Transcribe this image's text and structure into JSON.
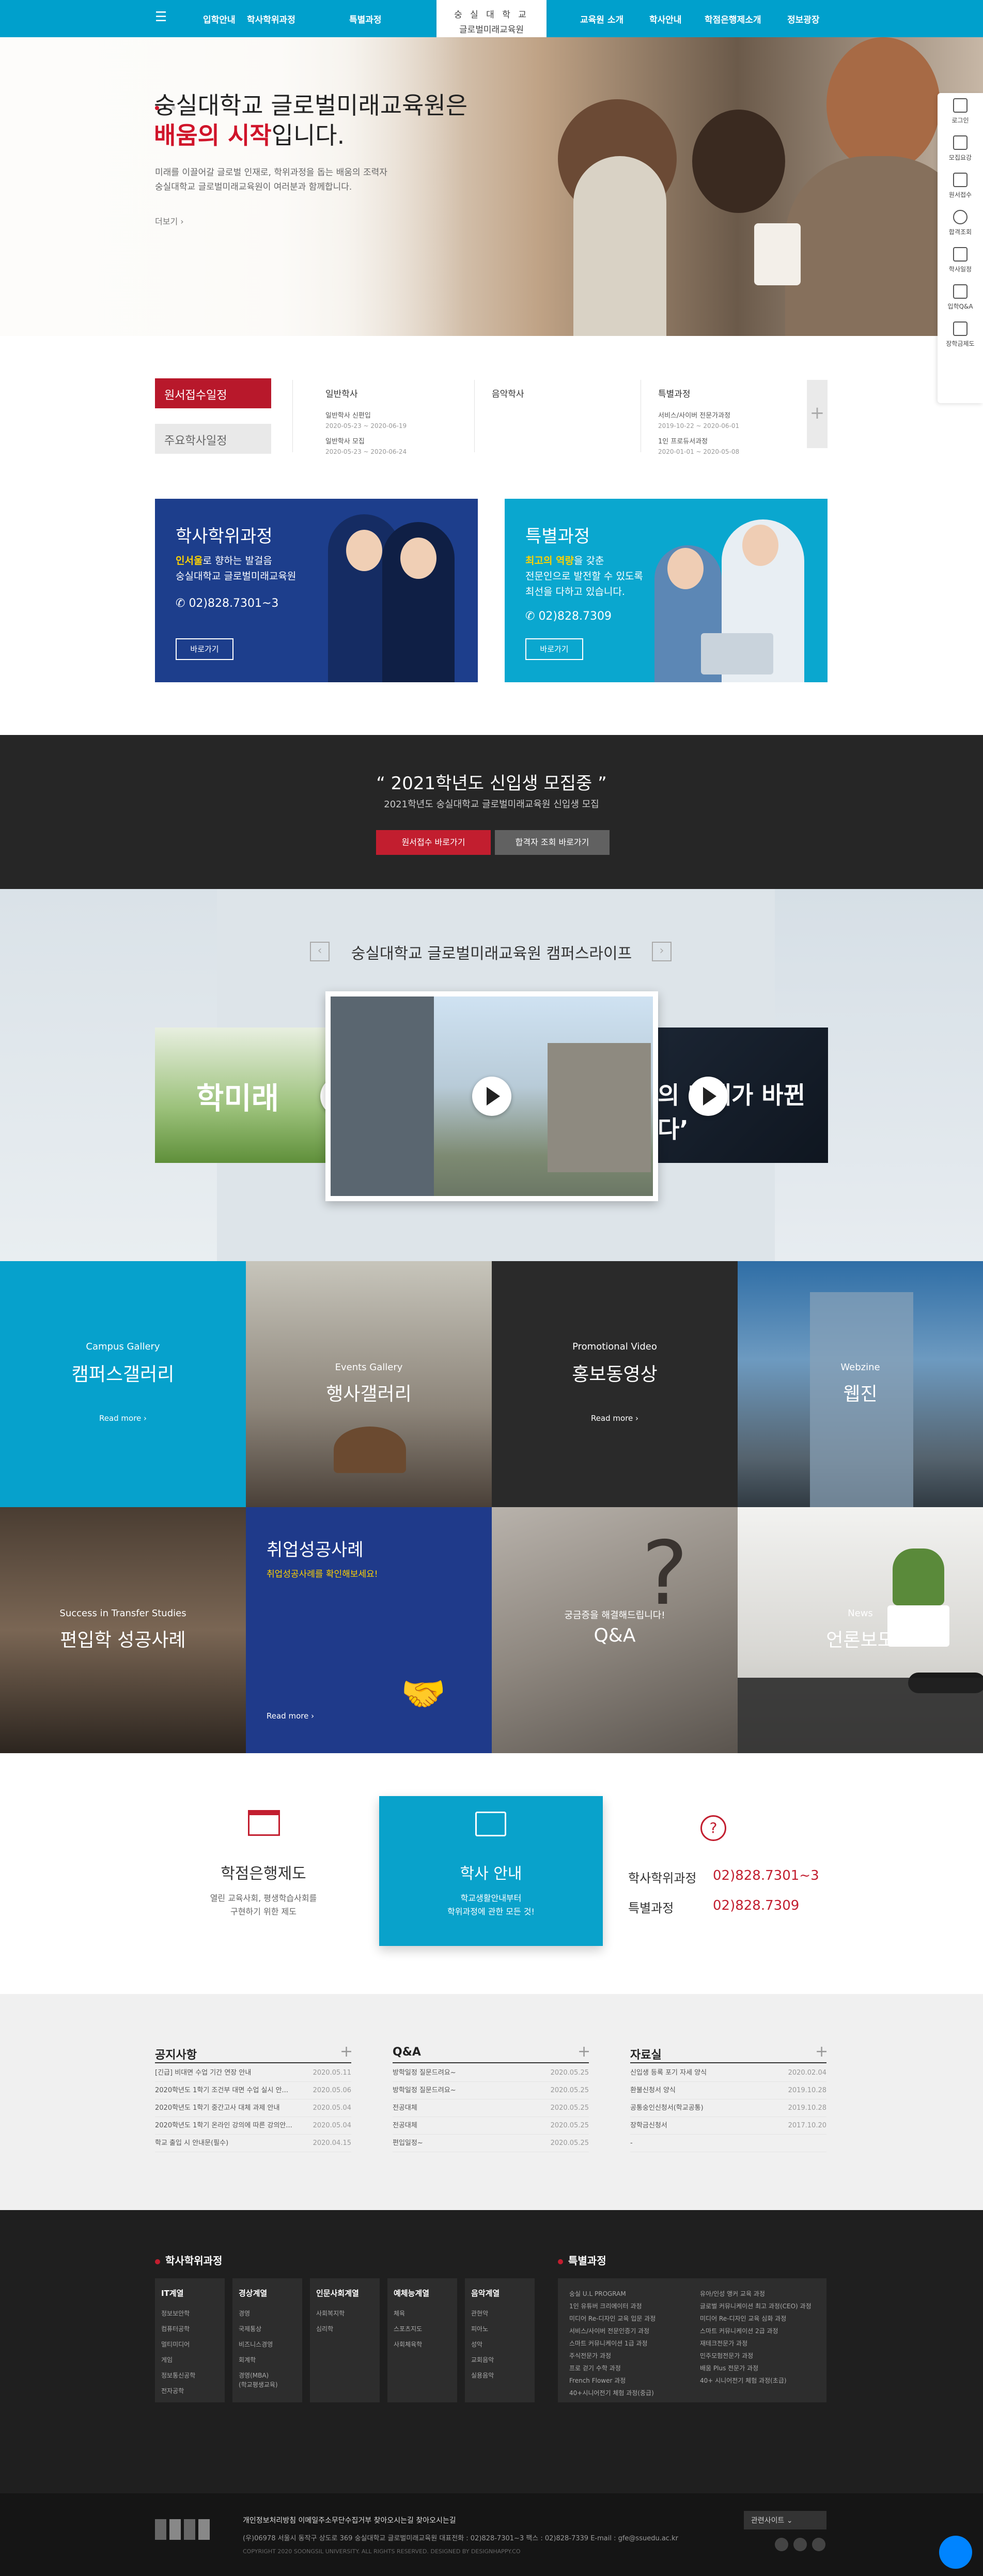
{
  "nav": {
    "left": [
      "입학안내",
      "학사학위과정",
      "특별과정"
    ],
    "right": [
      "교육원 소개",
      "학사안내",
      "학점은행제소개",
      "정보광장"
    ]
  },
  "logo": {
    "line1": "숭 실 대 학 교",
    "line2": "글로벌미래교육원"
  },
  "hero": {
    "line1": "숭실대학교 글로벌미래교육원은",
    "highlight": "배움의 시작",
    "line2_suffix": "입니다.",
    "desc1": "미래를 이끌어갈 글로벌 인재로, 학위과정을 돕는 배움의 조력자",
    "desc2": "숭실대학교 글로벌미래교육원이 여러분과 함께합니다.",
    "more": "더보기 ›"
  },
  "quick": [
    "로그인",
    "모집요강",
    "원서접수",
    "합격조회",
    "학사일정",
    "입학Q&A",
    "장학금제도"
  ],
  "schedule": {
    "tab_active": "원서접수일정",
    "tab_inactive": "주요학사일정",
    "cols": [
      {
        "title": "일반학사",
        "items": [
          {
            "name": "일반학사 신편입",
            "date": "2020-05-23 ~ 2020-06-19"
          },
          {
            "name": "일반학사 모집",
            "date": "2020-05-23 ~ 2020-06-24"
          }
        ]
      },
      {
        "title": "음악학사",
        "items": []
      },
      {
        "title": "특별과정",
        "items": [
          {
            "name": "서비스/사이버 전문가과정",
            "date": "2019-10-22 ~ 2020-06-01"
          },
          {
            "name": "1인 프로듀서과정",
            "date": "2020-01-01 ~ 2020-05-08"
          }
        ]
      }
    ],
    "more_symbol": "+"
  },
  "card_bachelor": {
    "title": "학사학위과정",
    "desc_hl": "인서울",
    "desc1_suffix": "로 향하는 발걸음",
    "desc2": "숭실대학교 글로벌미래교육원",
    "tel": "02)828.7301~3",
    "btn": "바로가기"
  },
  "card_special": {
    "title": "특별과정",
    "desc_hl": "최고의 역량",
    "desc1_suffix": "을 갖춘",
    "desc2": "전문인으로 발전할 수 있도록",
    "desc3": "최선을 다하고 있습니다.",
    "tel": "02)828.7309",
    "btn": "바로가기"
  },
  "recruit": {
    "title": "“ 2021학년도 신입생 모집중 ”",
    "sub": "2021학년도 숭실대학교 글로벌미래교육원 신입생 모집",
    "btn_apply": "원서접수 바로가기",
    "btn_check": "합격자 조회 바로가기"
  },
  "campus_life": {
    "title": "숭실대학교 글로벌미래교육원 캠퍼스라이프",
    "prev": "‹",
    "next": "›",
    "video_left_text": "학미래",
    "video_right_text": "의 미래가 바뀐다’"
  },
  "tiles": [
    {
      "sub": "Campus Gallery",
      "title": "캠퍼스갤러리",
      "more": "Read more ›"
    },
    {
      "sub": "Events Gallery",
      "title": "행사갤러리",
      "more": ""
    },
    {
      "sub": "Promotional Video",
      "title": "홍보동영상",
      "more": "Read more ›"
    },
    {
      "sub": "Webzine",
      "title": "웹진",
      "more": ""
    },
    {
      "sub": "Success in Transfer Studies",
      "title": "편입학 성공사례",
      "more": ""
    },
    {
      "sub": "",
      "title": "취업성공사례",
      "desc": "취업성공사례를 확인해보세요!",
      "more": "Read more ›"
    },
    {
      "sub": "궁금증을 해결해드립니다!",
      "title": "Q&A",
      "more": ""
    },
    {
      "sub": "News",
      "title": "언론보도",
      "more": ""
    }
  ],
  "info": {
    "credit_title": "학점은행제도",
    "credit_desc1": "열린 교육사회, 평생학습사회를",
    "credit_desc2": "구현하기 위한 제도",
    "guide_title": "학사 안내",
    "guide_desc1": "학교생활안내부터",
    "guide_desc2": "학위과정에 관한 모든 것!",
    "contact1_label": "학사학위과정",
    "contact1_tel": "02)828.7301~3",
    "contact2_label": "특별과정",
    "contact2_tel": "02)828.7309"
  },
  "boards": [
    {
      "title": "공지사항",
      "rows": [
        {
          "t": "[긴급] 비대면 수업 기간 연장 안내",
          "d": "2020.05.11"
        },
        {
          "t": "2020학년도 1학기 조건부 대면 수업 실시 안...",
          "d": "2020.05.06"
        },
        {
          "t": "2020학년도 1학기 중간고사 대체 과제 안내",
          "d": "2020.05.04"
        },
        {
          "t": "2020학년도 1학기 온라인 강의에 따른 강의안...",
          "d": "2020.05.04"
        },
        {
          "t": "학교 출입 시 안내문(필수)",
          "d": "2020.04.15"
        }
      ]
    },
    {
      "title": "Q&A",
      "rows": [
        {
          "t": "방학일정 질문드려요~",
          "d": "2020.05.25"
        },
        {
          "t": "방학일정 질문드려요~",
          "d": "2020.05.25"
        },
        {
          "t": "전공대체",
          "d": "2020.05.25"
        },
        {
          "t": "전공대체",
          "d": "2020.05.25"
        },
        {
          "t": "편입일정~",
          "d": "2020.05.25"
        }
      ]
    },
    {
      "title": "자료실",
      "rows": [
        {
          "t": "신입생 등록 포기 자세 양식",
          "d": "2020.02.04"
        },
        {
          "t": "환불신청서 양식",
          "d": "2019.10.28"
        },
        {
          "t": "공통숭인신청서(학교공통)",
          "d": "2019.10.28"
        },
        {
          "t": "장학금신청서",
          "d": "2017.10.20"
        },
        {
          "t": "-",
          "d": ""
        }
      ]
    }
  ],
  "footer": {
    "bachelor_title": "학사학위과정",
    "special_title": "특별과정",
    "cols": [
      {
        "h": "IT계열",
        "items": [
          "정보보안학",
          "컴퓨터공학",
          "멀티미디어",
          "게임",
          "정보통신공학",
          "전자공학"
        ]
      },
      {
        "h": "경상계열",
        "items": [
          "경영",
          "국제통상",
          "비즈니스경영",
          "회계학",
          "경영(MBA)",
          "(학교평생교육)"
        ]
      },
      {
        "h": "인문사회계열",
        "items": [
          "사회복지학",
          "심리학"
        ]
      },
      {
        "h": "예체능계열",
        "items": [
          "체육",
          "스포츠지도",
          "사회체육학"
        ]
      },
      {
        "h": "음악계열",
        "items": [
          "관현악",
          "피아노",
          "성악",
          "교회음악",
          "실용음악"
        ]
      }
    ],
    "special_left": [
      "숭실 U.L PROGRAM",
      "1인 유튜버 크리에이터 과정",
      "미디어 Re-디자인 교육 입문 과정",
      "서비스/사이버 전문인증기 과정",
      "스마트 커뮤니케이션 1급 과정",
      "주식전문가 과정",
      "프로 걷기 수학 과정",
      "French Flower 과정",
      "40+시니어전기 체험 과정(중급)"
    ],
    "special_right": [
      "유아/인성 앵커 교육 과정",
      "글로벌 커뮤니케이션 최고 과정(CEO) 과정",
      "미디어 Re-디자인 교육 심화 과정",
      "스마트 커뮤니케이션 2급 과정",
      "재테크전문가 과정",
      "민주모험전문가 과정",
      "배움 Plus 전문가 과정",
      "40+ 시니어전기 체험 과정(초급)"
    ],
    "links": "개인정보처리방침    이메일주소무단수집거부    찾아오시는길    찾아오시는길",
    "addr": "(우)06978 서울시 동작구 상도로 369 숭실대학교 글로벌미래교육원   대표전화 : 02)828-7301~3   팩스 : 02)828-7339   E-mail : gfe@ssuedu.ac.kr",
    "copy": "COPYRIGHT 2020 SOONGSIL UNIVERSITY. ALL RIGHTS RESERVED.    DESIGNED BY DESIGNHAPPY.CO",
    "family_site": "관련사이트 ⌄"
  }
}
